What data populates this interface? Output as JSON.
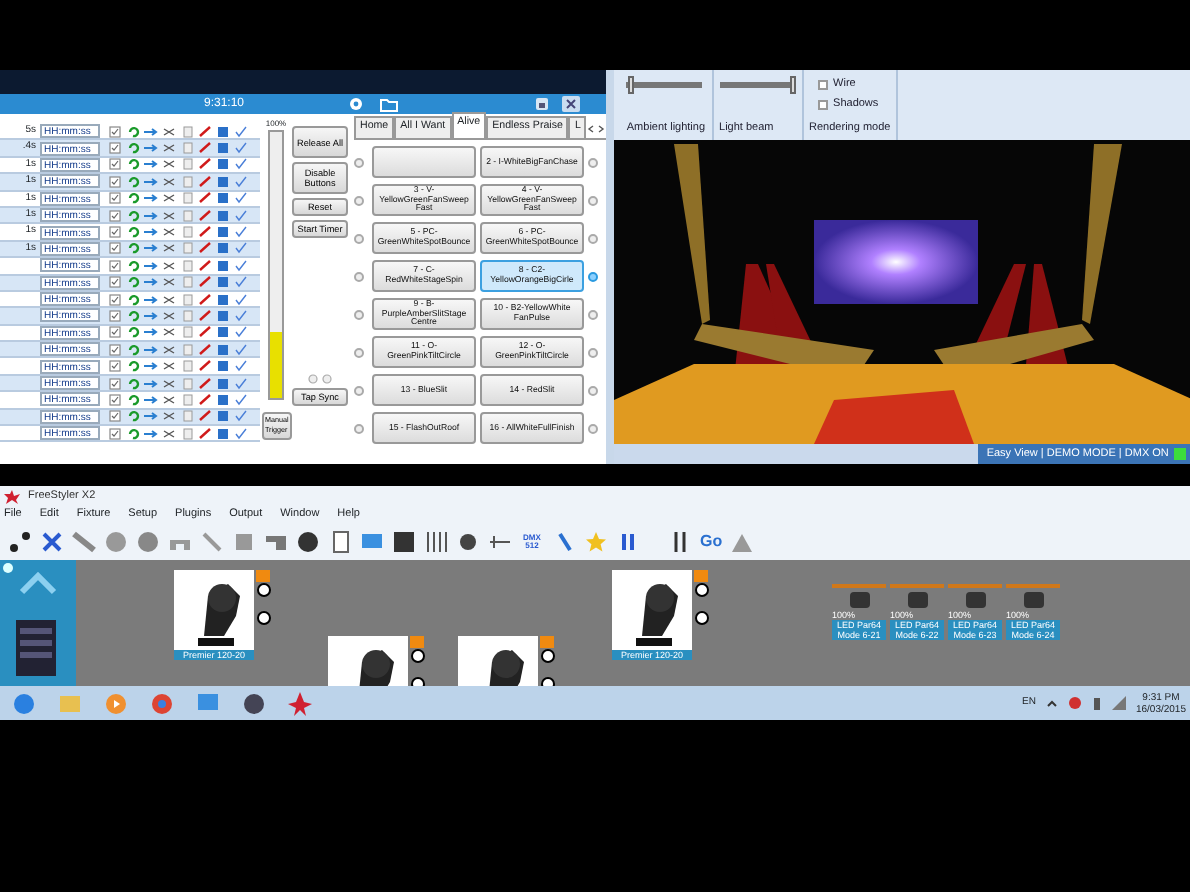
{
  "cue_window": {
    "clock": "9:31:10",
    "rows": [
      {
        "delay": "5s",
        "time": "HH:mm:ss"
      },
      {
        "delay": ".4s",
        "time": "HH:mm:ss"
      },
      {
        "delay": "1s",
        "time": "HH:mm:ss"
      },
      {
        "delay": "1s",
        "time": "HH:mm:ss"
      },
      {
        "delay": "1s",
        "time": "HH:mm:ss"
      },
      {
        "delay": "1s",
        "time": "HH:mm:ss"
      },
      {
        "delay": "1s",
        "time": "HH:mm:ss"
      },
      {
        "delay": "1s",
        "time": "HH:mm:ss"
      },
      {
        "time": "HH:mm:ss"
      },
      {
        "time": "HH:mm:ss"
      },
      {
        "time": "HH:mm:ss"
      },
      {
        "time": "HH:mm:ss"
      },
      {
        "time": "HH:mm:ss"
      },
      {
        "time": "HH:mm:ss"
      },
      {
        "time": "HH:mm:ss"
      },
      {
        "time": "HH:mm:ss"
      },
      {
        "time": "HH:mm:ss"
      },
      {
        "time": "HH:mm:ss"
      },
      {
        "time": "HH:mm:ss"
      }
    ],
    "master_fader": {
      "label": "100%",
      "level": 0.25
    },
    "manual_trigger": "Manual Trigger",
    "side_buttons": [
      "Release All",
      "Disable Buttons",
      "Reset",
      "Start Timer"
    ],
    "tap_sync": "Tap Sync",
    "tabs": [
      {
        "label": "Home",
        "selected": false
      },
      {
        "label": "All I Want",
        "selected": false
      },
      {
        "label": "Alive",
        "selected": true
      },
      {
        "label": "Endless Praise",
        "selected": false
      },
      {
        "label": "L",
        "selected": false
      }
    ],
    "cues": [
      {
        "selected": false
      },
      {
        "label": "2 - I-WhiteBigFanChase",
        "selected": false
      },
      {
        "label": "3 - V-YellowGreenFanSweep Fast",
        "selected": false
      },
      {
        "label": "4 - V-YellowGreenFanSweep Fast",
        "selected": false
      },
      {
        "label": "5 - PC-GreenWhiteSpotBounce",
        "selected": false
      },
      {
        "label": "6 - PC-GreenWhiteSpotBounce",
        "selected": false
      },
      {
        "label": "7 - C-RedWhiteStageSpin",
        "selected": false
      },
      {
        "label": "8 - C2-YellowOrangeBigCirle",
        "selected": true
      },
      {
        "label": "9 - B-PurpleAmberSlitStage Centre",
        "selected": false
      },
      {
        "label": "10 - B2-YellowWhite FanPulse",
        "selected": false
      },
      {
        "label": "11 - O-GreenPinkTiltCircle",
        "selected": false
      },
      {
        "label": "12 - O-GreenPinkTiltCircle",
        "selected": false
      },
      {
        "label": "13 - BlueSlit",
        "selected": false
      },
      {
        "label": "14 - RedSlit",
        "selected": false
      },
      {
        "label": "15 - FlashOutRoof",
        "selected": false
      },
      {
        "label": "16 - AllWhiteFullFinish",
        "selected": false
      }
    ]
  },
  "view_3d": {
    "sliders": [
      {
        "label": "Ambient lighting",
        "level": 0.02
      },
      {
        "label": "Light beam",
        "level": 1
      }
    ],
    "checkboxes": [
      {
        "label": "Wire",
        "checked": false
      },
      {
        "label": "Shadows",
        "checked": false
      }
    ],
    "group_label": "Rendering mode",
    "status": "Easy View | DEMO MODE | DMX ON"
  },
  "freestyler": {
    "title": "FreeStyler X2",
    "menu": [
      "File",
      "Edit",
      "Fixture",
      "Setup",
      "Plugins",
      "Output",
      "Window",
      "Help"
    ],
    "dmx_button": "DMX 512",
    "go_button": "Go",
    "fixtures": [
      {
        "kind": "moving_head",
        "label": "Premier 120-20"
      },
      {
        "kind": "moving_head"
      },
      {
        "kind": "moving_head"
      },
      {
        "kind": "moving_head",
        "label": "Premier 120-20"
      },
      {
        "kind": "par",
        "percent": "100%",
        "label": "LED Par64 Mode 6-21"
      },
      {
        "kind": "par",
        "percent": "100%",
        "label": "LED Par64 Mode 6-22"
      },
      {
        "kind": "par",
        "percent": "100%",
        "label": "LED Par64 Mode 6-23"
      },
      {
        "kind": "par",
        "percent": "100%",
        "label": "LED Par64 Mode 6-24"
      }
    ]
  },
  "taskbar": {
    "language": "EN",
    "time": "9:31 PM",
    "date": "16/03/2015"
  }
}
